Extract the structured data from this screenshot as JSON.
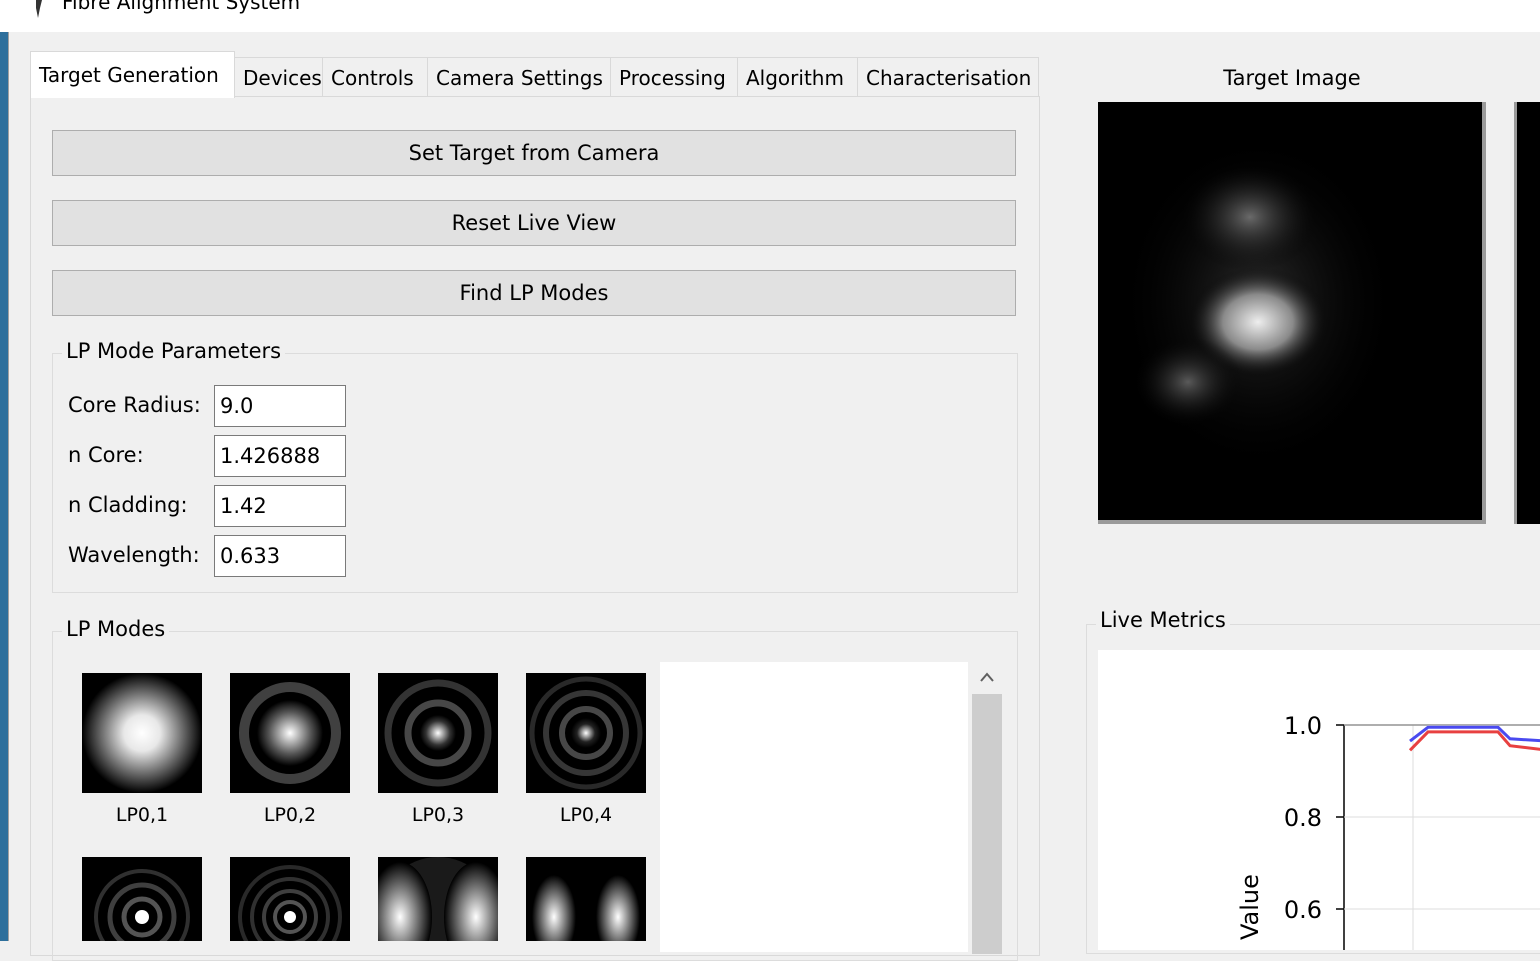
{
  "window": {
    "title": "Fibre Alignment System"
  },
  "tabs": [
    {
      "label": "Target Generation",
      "active": true
    },
    {
      "label": "Devices",
      "active": false
    },
    {
      "label": "Controls",
      "active": false
    },
    {
      "label": "Camera Settings",
      "active": false
    },
    {
      "label": "Processing",
      "active": false
    },
    {
      "label": "Algorithm",
      "active": false
    },
    {
      "label": "Characterisation",
      "active": false
    }
  ],
  "buttons": {
    "set_target": "Set Target from Camera",
    "reset_live": "Reset Live View",
    "find_lp": "Find LP Modes"
  },
  "lp_params": {
    "title": "LP Mode Parameters",
    "core_radius_label": "Core Radius:",
    "core_radius_value": "9.0",
    "n_core_label": "n Core:",
    "n_core_value": "1.426888",
    "n_cladding_label": "n Cladding:",
    "n_cladding_value": "1.42",
    "wavelength_label": "Wavelength:",
    "wavelength_value": "0.633"
  },
  "lp_modes": {
    "title": "LP Modes",
    "items": [
      "LP0,1",
      "LP0,2",
      "LP0,3",
      "LP0,4"
    ]
  },
  "target": {
    "title": "Target Image"
  },
  "metrics": {
    "title": "Live Metrics"
  },
  "chart_data": {
    "type": "line",
    "ylabel": "Value",
    "yticks": [
      "1.0",
      "0.8",
      "0.6"
    ],
    "series": [
      {
        "color": "#4a4af0",
        "values": [
          0.965,
          0.995,
          0.995,
          0.995,
          0.995,
          0.97,
          0.965
        ]
      },
      {
        "color": "#e84040",
        "values": [
          0.945,
          0.985,
          0.985,
          0.985,
          0.985,
          0.955,
          0.945
        ]
      }
    ],
    "grid": true
  },
  "colors": {
    "series_blue": "#4a4af0",
    "series_red": "#e84040",
    "accent_frame": "#2d6f9c"
  }
}
